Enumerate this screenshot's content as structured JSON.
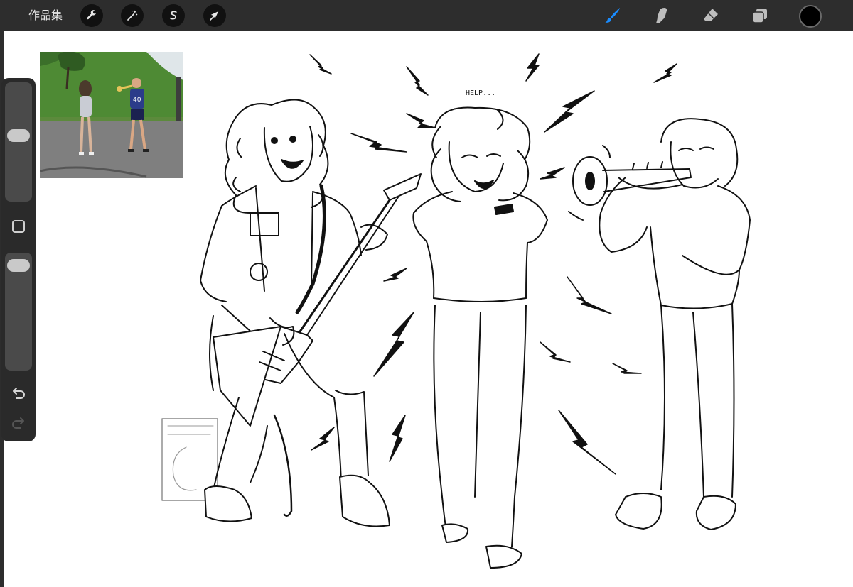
{
  "toolbar": {
    "gallery_label": "作品集",
    "left_tools": [
      {
        "name": "actions",
        "icon": "wrench-icon"
      },
      {
        "name": "adjustments",
        "icon": "magic-wand-icon"
      },
      {
        "name": "selection",
        "icon": "selection-s-icon"
      },
      {
        "name": "transform",
        "icon": "arrow-cursor-icon"
      }
    ],
    "right_tools": [
      {
        "name": "brush",
        "icon": "brush-icon",
        "active": true
      },
      {
        "name": "smudge",
        "icon": "smudge-finger-icon"
      },
      {
        "name": "eraser",
        "icon": "eraser-icon"
      },
      {
        "name": "layers",
        "icon": "layers-icon"
      }
    ],
    "current_color": "#000000",
    "accent_color": "#1a8cff"
  },
  "sidebar": {
    "brush_size_level": 0.44,
    "opacity_level": 0.06
  },
  "canvas": {
    "speech_text": "HELP..."
  }
}
